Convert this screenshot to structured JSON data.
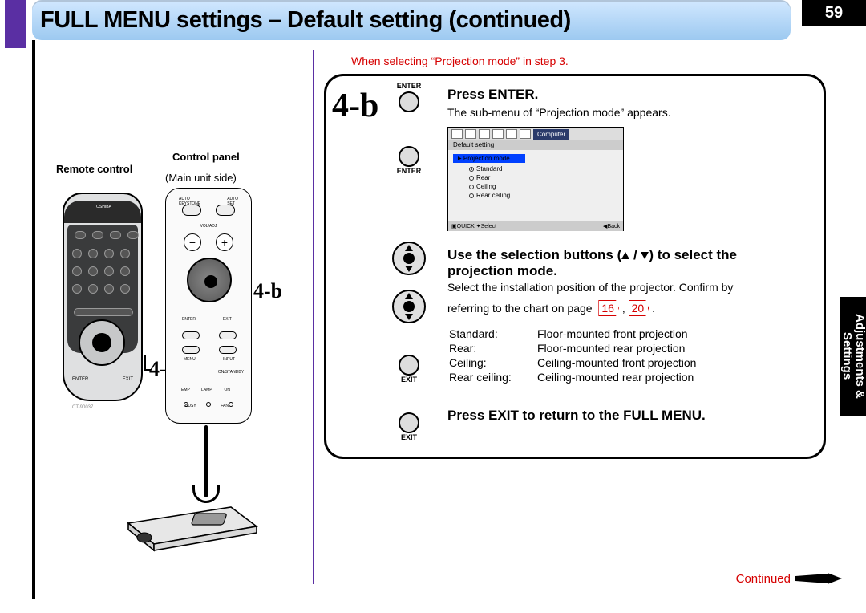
{
  "page_number": "59",
  "title": "FULL MENU settings – Default setting (continued)",
  "left": {
    "remote_control": "Remote control",
    "control_panel": "Control panel",
    "main_unit_side": "(Main unit side)",
    "brand": "TOSHIBA",
    "enter": "ENTER",
    "exit": "EXIT",
    "voladj": "VOL/ADJ",
    "model": "CT-90037",
    "callout": "4-b",
    "panel": {
      "auto_keystone": "AUTO\nKEYSTONE",
      "auto_set": "AUTO\nSET",
      "voladj": "VOL/ADJ",
      "enter": "ENTER",
      "exit": "EXIT",
      "menu": "MENU",
      "input": "INPUT",
      "standby": "ON/STANDBY",
      "temp": "TEMP",
      "lamp": "LAMP",
      "on": "ON",
      "busy": "BUSY",
      "fan": "FAN"
    }
  },
  "note_red": "When selecting “Projection mode” in step 3.",
  "step_badge": "4-b",
  "buttons": {
    "enter": "ENTER",
    "exit": "EXIT"
  },
  "r": {
    "press_enter": "Press ENTER.",
    "press_enter_sub": "The sub-menu of “Projection mode” appears.",
    "use_selection": "Use the selection buttons (",
    "use_selection_b": ") to select the projection mode.",
    "select_install": "Select the installation position of the projector. Confirm by",
    "refer": "referring to the chart on page",
    "p16": "16",
    "comma": ",",
    "p20": "20",
    "dot": ".",
    "modes": [
      {
        "k": "Standard:",
        "v": "Floor-mounted front projection"
      },
      {
        "k": "Rear:",
        "v": "Floor-mounted rear projection"
      },
      {
        "k": "Ceiling:",
        "v": "Ceiling-mounted front projection"
      },
      {
        "k": "Rear ceiling:",
        "v": "Ceiling-mounted rear projection"
      }
    ],
    "press_exit": "Press EXIT to return to the FULL MENU."
  },
  "osd": {
    "tab": "Computer",
    "subhead": "Default setting",
    "header": "Projection mode",
    "opts": [
      "Standard",
      "Rear",
      "Ceiling",
      "Rear ceiling"
    ],
    "quick": "QUICK",
    "select": "Select",
    "back": "Back"
  },
  "sidetab": "Adjustments &\nSettings",
  "continued": "Continued"
}
